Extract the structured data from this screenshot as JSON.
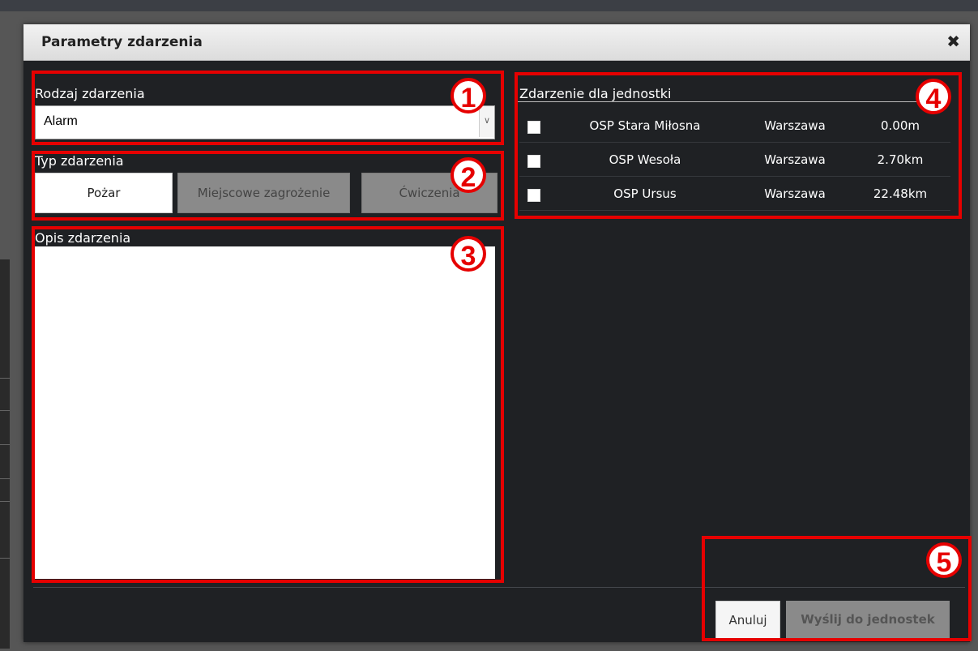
{
  "dialog": {
    "title": "Parametry zdarzenia",
    "close_symbol": "✖"
  },
  "event_kind": {
    "label": "Rodzaj zdarzenia",
    "selected": "Alarm"
  },
  "event_type": {
    "label": "Typ zdarzenia",
    "options": [
      "Pożar",
      "Miejscowe zagrożenie",
      "Ćwiczenia"
    ],
    "active_index": 0
  },
  "description": {
    "label": "Opis zdarzenia",
    "value": ""
  },
  "units": {
    "label": "Zdarzenie dla jednostki",
    "rows": [
      {
        "name": "OSP Stara Miłosna",
        "city": "Warszawa",
        "distance": "0.00m"
      },
      {
        "name": "OSP Wesoła",
        "city": "Warszawa",
        "distance": "2.70km"
      },
      {
        "name": "OSP Ursus",
        "city": "Warszawa",
        "distance": "22.48km"
      }
    ]
  },
  "actions": {
    "cancel": "Anuluj",
    "send": "Wyślij do jednostek"
  },
  "annotations": [
    "1",
    "2",
    "3",
    "4",
    "5"
  ],
  "colors": {
    "annotation": "#e60000",
    "dialog_bg": "#1f2124",
    "button_inactive": "#8a8a8a"
  }
}
